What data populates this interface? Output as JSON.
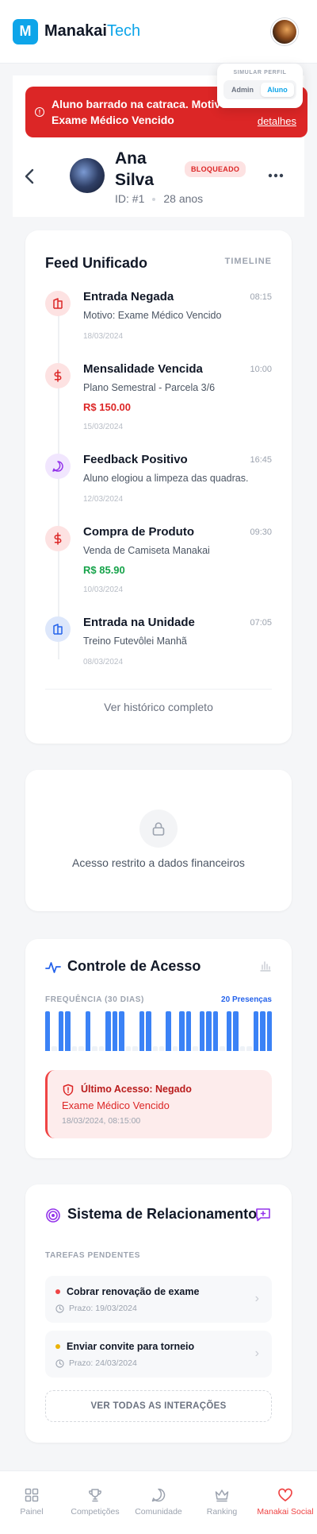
{
  "header": {
    "logo_letter": "M",
    "brand_primary": "Manakai",
    "brand_secondary": "Tech"
  },
  "profile_simulator": {
    "title": "SIMULAR PERFIL",
    "options": [
      "Admin",
      "Aluno"
    ],
    "selected": "Aluno"
  },
  "alert": {
    "message": "Aluno barrado na catraca. Motivo: Exame Médico Vencido",
    "link": "detalhes"
  },
  "profile": {
    "name": "Ana Silva",
    "id": "ID: #1",
    "age": "28 anos",
    "status": "BLOQUEADO"
  },
  "feed": {
    "title": "Feed Unificado",
    "tag": "TIMELINE",
    "items": [
      {
        "title": "Entrada Negada",
        "time": "08:15",
        "description": "Motivo: Exame Médico Vencido",
        "amount": "",
        "date": "18/03/2024",
        "icon": "turnstile-icon",
        "color": "red"
      },
      {
        "title": "Mensalidade Vencida",
        "time": "10:00",
        "description": "Plano Semestral - Parcela 3/6",
        "amount": "R$ 150.00",
        "date": "15/03/2024",
        "icon": "dollar-icon",
        "color": "red"
      },
      {
        "title": "Feedback Positivo",
        "time": "16:45",
        "description": "Aluno elogiou a limpeza das quadras.",
        "amount": "",
        "date": "12/03/2024",
        "icon": "message-icon",
        "color": "purple"
      },
      {
        "title": "Compra de Produto",
        "time": "09:30",
        "description": "Venda de Camiseta Manakai",
        "amount": "R$ 85.90",
        "date": "10/03/2024",
        "icon": "dollar-icon",
        "color": "red"
      },
      {
        "title": "Entrada na Unidade",
        "time": "07:05",
        "description": "Treino Futevôlei Manhã",
        "amount": "",
        "date": "08/03/2024",
        "icon": "turnstile-icon",
        "color": "blue"
      }
    ],
    "more_label": "Ver histórico completo"
  },
  "restricted": {
    "message": "Acesso restrito a dados financeiros"
  },
  "access": {
    "title": "Controle de Acesso",
    "frequency_label": "FREQUÊNCIA (30 DIAS)",
    "presence_count": "20 Presenças",
    "days": [
      1,
      0,
      1,
      1,
      0,
      0,
      1,
      0,
      0,
      1,
      1,
      1,
      0,
      0,
      1,
      1,
      0,
      0,
      1,
      0,
      1,
      1,
      0,
      1,
      1,
      1,
      0,
      1,
      1,
      0,
      0,
      1,
      1,
      1
    ],
    "last_access": {
      "title": "Último Acesso: Negado",
      "reason": "Exame Médico Vencido",
      "datetime": "18/03/2024, 08:15:00"
    }
  },
  "relationship": {
    "title": "Sistema de Relacionamento",
    "tasks_label": "TAREFAS PENDENTES",
    "tasks": [
      {
        "title": "Cobrar renovação de exame",
        "due": "Prazo: 19/03/2024",
        "priority_color": "#ef4444"
      },
      {
        "title": "Enviar convite para torneio",
        "due": "Prazo: 24/03/2024",
        "priority_color": "#eab308"
      }
    ],
    "all_label": "VER TODAS AS INTERAÇÕES"
  },
  "nav": {
    "items": [
      "Painel",
      "Competições",
      "Comunidade",
      "Ranking",
      "Manakai Social"
    ],
    "active": "Manakai Social"
  },
  "colors": {
    "brand": "#0ea5e9",
    "danger": "#dc2626",
    "success": "#16a34a",
    "bar_present": "#3b82f6",
    "bar_absent": "#eef2f7"
  }
}
